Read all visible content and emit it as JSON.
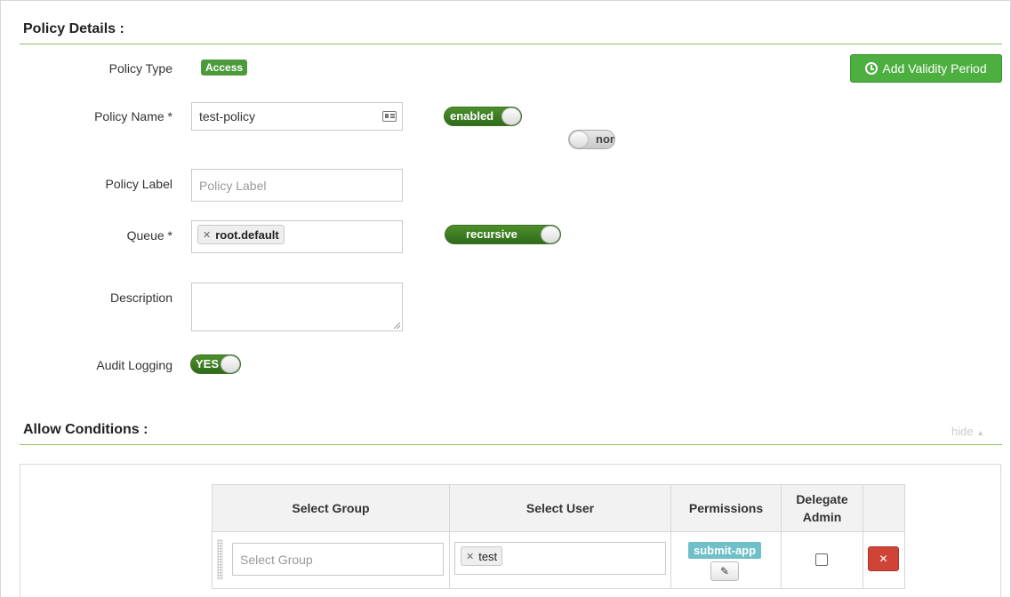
{
  "policy_details": {
    "title": "Policy Details :",
    "policy_type_label": "Policy Type",
    "policy_type_value": "Access",
    "add_validity_label": "Add Validity Period",
    "policy_name_label": "Policy Name *",
    "policy_name_value": "test-policy",
    "enabled_toggle": "enabled",
    "override_toggle": "nor",
    "policy_label_label": "Policy Label",
    "policy_label_placeholder": "Policy Label",
    "queue_label": "Queue *",
    "queue_tags": [
      "root.default"
    ],
    "recursive_toggle": "recursive",
    "description_label": "Description",
    "audit_logging_label": "Audit Logging",
    "audit_logging_value": "YES"
  },
  "allow_conditions": {
    "title": "Allow Conditions :",
    "hide_link": "hide",
    "columns": [
      "Select Group",
      "Select User",
      "Permissions",
      "Delegate\nAdmin",
      ""
    ],
    "rows": [
      {
        "group_placeholder": "Select Group",
        "user_tags": [
          "test"
        ],
        "permissions": [
          "submit-app"
        ],
        "delegate_admin": false
      }
    ]
  },
  "colors": {
    "accent_green": "#4caf3f",
    "section_rule": "#8fbf6a",
    "permission_tag": "#6fc0c9",
    "delete_red": "#d04437"
  }
}
